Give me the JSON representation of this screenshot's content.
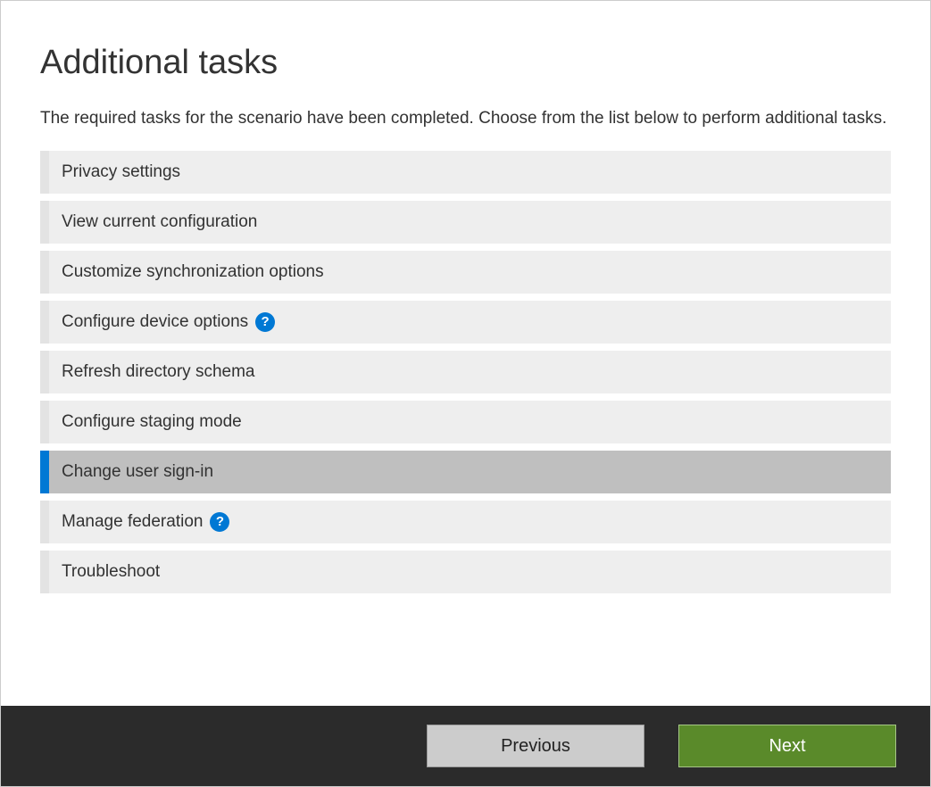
{
  "page": {
    "title": "Additional tasks",
    "description": "The required tasks for the scenario have been completed. Choose from the list below to perform additional tasks."
  },
  "tasks": [
    {
      "label": "Privacy settings",
      "help": false,
      "selected": false
    },
    {
      "label": "View current configuration",
      "help": false,
      "selected": false
    },
    {
      "label": "Customize synchronization options",
      "help": false,
      "selected": false
    },
    {
      "label": "Configure device options",
      "help": true,
      "selected": false
    },
    {
      "label": "Refresh directory schema",
      "help": false,
      "selected": false
    },
    {
      "label": "Configure staging mode",
      "help": false,
      "selected": false
    },
    {
      "label": "Change user sign-in",
      "help": false,
      "selected": true
    },
    {
      "label": "Manage federation",
      "help": true,
      "selected": false
    },
    {
      "label": "Troubleshoot",
      "help": false,
      "selected": false
    }
  ],
  "footer": {
    "previous_label": "Previous",
    "next_label": "Next"
  },
  "colors": {
    "accent": "#0078d4",
    "selected_bg": "#bfbfbf",
    "item_bg": "#eeeeee",
    "footer_bg": "#2b2b2b",
    "next_bg": "#5a8a2a",
    "prev_bg": "#cccccc"
  }
}
